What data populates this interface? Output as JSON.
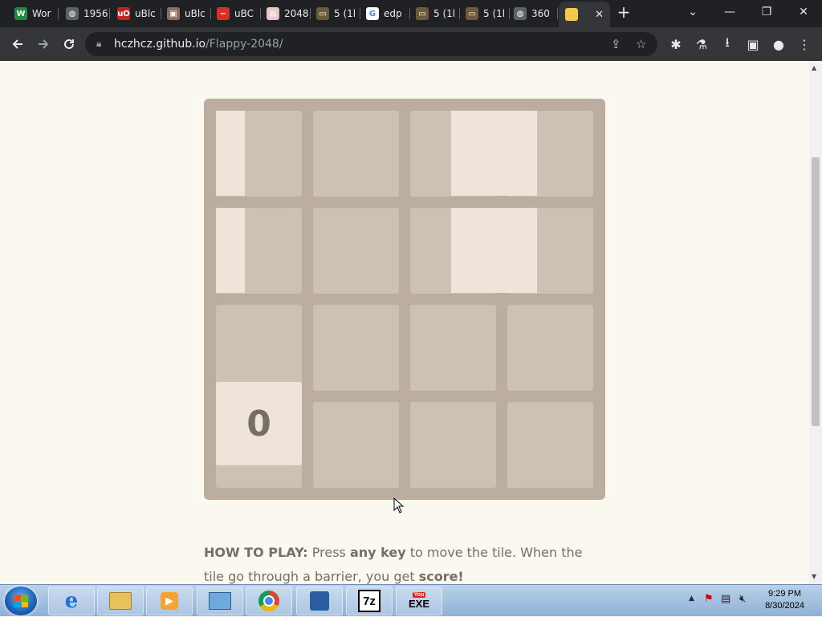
{
  "browser": {
    "tabs": [
      {
        "title": "Wor",
        "icon": "word-icon",
        "icon_text": "W",
        "icon_bg": "#1e8e3e"
      },
      {
        "title": "1956",
        "icon": "globe-icon",
        "icon_text": "◍",
        "icon_bg": "#5f6368"
      },
      {
        "title": "uBlc",
        "icon": "ublock-icon",
        "icon_text": "uO",
        "icon_bg": "#c5221f"
      },
      {
        "title": "uBlc",
        "icon": "image-icon",
        "icon_text": "▣",
        "icon_bg": "#8d6e63"
      },
      {
        "title": "uBC",
        "icon": "stop-icon",
        "icon_text": "−",
        "icon_bg": "#d93025"
      },
      {
        "title": "2048",
        "icon": "page-icon",
        "icon_text": "▤",
        "icon_bg": "#e8c6c6"
      },
      {
        "title": "5 (1l",
        "icon": "folder-icon",
        "icon_text": "▭",
        "icon_bg": "#6d5a3a"
      },
      {
        "title": "edp",
        "icon": "google-icon",
        "icon_text": "G",
        "icon_bg": "#ffffff"
      },
      {
        "title": "5 (1l",
        "icon": "folder-icon",
        "icon_text": "▭",
        "icon_bg": "#6d5a3a"
      },
      {
        "title": "5 (1l",
        "icon": "folder-icon",
        "icon_text": "▭",
        "icon_bg": "#6d5a3a"
      },
      {
        "title": "360",
        "icon": "globe-icon",
        "icon_text": "◍",
        "icon_bg": "#5f6368"
      },
      {
        "title": "",
        "icon": "flappy-2048-icon",
        "icon_text": "",
        "icon_bg": "#f2c94c",
        "active": true
      }
    ],
    "new_tab": "+",
    "url_host": "hczhcz.github.io",
    "url_path": "/Flappy-2048/"
  },
  "game": {
    "tile_value": "0",
    "howto": {
      "label": "HOW TO PLAY:",
      "t1": " Press ",
      "key": "any key",
      "t2": " to move the tile. When the tile go through a barrier, you get ",
      "score": "score!"
    }
  },
  "taskbar": {
    "apps": [
      "internet-explorer-icon",
      "file-explorer-icon",
      "media-player-icon",
      "control-panel-icon",
      "chrome-icon",
      "app-icon",
      "7zip-icon",
      "youtube-exe-icon"
    ],
    "sevenzip_label": "7z",
    "exe_label": "EXE",
    "exe_top_label": "You",
    "clock_time": "9:29 PM",
    "clock_date": "8/30/2024"
  },
  "colors": {
    "board": "#bbada0",
    "cell": "#cdc1b4",
    "tile": "#eee4da",
    "page_bg": "#faf8ef",
    "text": "#776e65"
  }
}
